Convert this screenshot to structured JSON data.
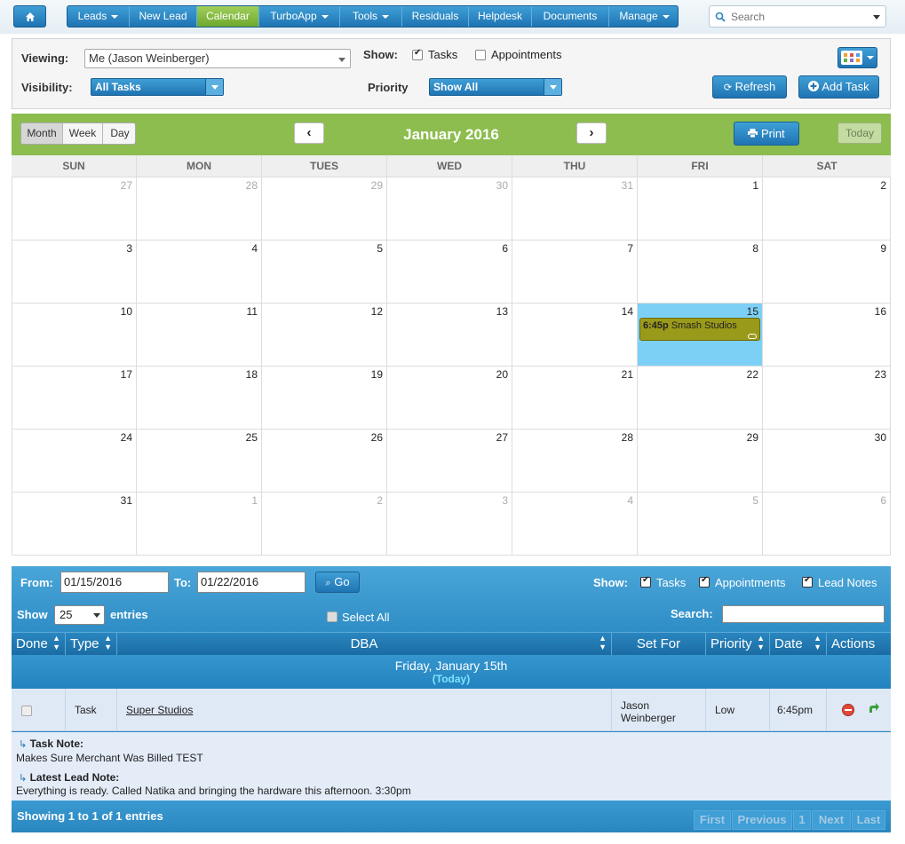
{
  "nav": {
    "items": [
      {
        "label": "Leads",
        "dropdown": true
      },
      {
        "label": "New Lead",
        "dropdown": false
      },
      {
        "label": "Calendar",
        "dropdown": false,
        "active": true
      },
      {
        "label": "TurboApp",
        "dropdown": true
      },
      {
        "label": "Tools",
        "dropdown": true
      },
      {
        "label": "Residuals",
        "dropdown": false
      },
      {
        "label": "Helpdesk",
        "dropdown": false
      },
      {
        "label": "Documents",
        "dropdown": false
      },
      {
        "label": "Manage",
        "dropdown": true
      }
    ],
    "search_placeholder": "Search"
  },
  "filters": {
    "viewing_label": "Viewing:",
    "viewing_value": "Me (Jason Weinberger)",
    "visibility_label": "Visibility:",
    "visibility_value": "All Tasks",
    "show_label": "Show:",
    "show_tasks": "Tasks",
    "show_appointments": "Appointments",
    "priority_label": "Priority",
    "priority_value": "Show All",
    "refresh_label": "Refresh",
    "add_task_label": "Add Task"
  },
  "calendar": {
    "view_tabs": [
      "Month",
      "Week",
      "Day"
    ],
    "active_view": "Month",
    "title": "January 2016",
    "prev_label": "‹",
    "next_label": "›",
    "print_label": "Print",
    "today_label": "Today",
    "weekdays": [
      "SUN",
      "MON",
      "TUES",
      "WED",
      "THU",
      "FRI",
      "SAT"
    ],
    "weeks": [
      [
        {
          "d": "27",
          "other": true
        },
        {
          "d": "28",
          "other": true
        },
        {
          "d": "29",
          "other": true
        },
        {
          "d": "30",
          "other": true
        },
        {
          "d": "31",
          "other": true
        },
        {
          "d": "1"
        },
        {
          "d": "2"
        }
      ],
      [
        {
          "d": "3"
        },
        {
          "d": "4"
        },
        {
          "d": "5"
        },
        {
          "d": "6"
        },
        {
          "d": "7"
        },
        {
          "d": "8"
        },
        {
          "d": "9"
        }
      ],
      [
        {
          "d": "10"
        },
        {
          "d": "11"
        },
        {
          "d": "12"
        },
        {
          "d": "13"
        },
        {
          "d": "14"
        },
        {
          "d": "15",
          "today": true
        },
        {
          "d": "16"
        }
      ],
      [
        {
          "d": "17"
        },
        {
          "d": "18"
        },
        {
          "d": "19"
        },
        {
          "d": "20"
        },
        {
          "d": "21"
        },
        {
          "d": "22"
        },
        {
          "d": "23"
        }
      ],
      [
        {
          "d": "24"
        },
        {
          "d": "25"
        },
        {
          "d": "26"
        },
        {
          "d": "27"
        },
        {
          "d": "28"
        },
        {
          "d": "29"
        },
        {
          "d": "30"
        }
      ],
      [
        {
          "d": "31"
        },
        {
          "d": "1",
          "other": true
        },
        {
          "d": "2",
          "other": true
        },
        {
          "d": "3",
          "other": true
        },
        {
          "d": "4",
          "other": true
        },
        {
          "d": "5",
          "other": true
        },
        {
          "d": "6",
          "other": true
        }
      ]
    ],
    "event": {
      "time": "6:45p",
      "title": "Smash Studios",
      "day": "15"
    }
  },
  "tasks": {
    "from_label": "From:",
    "from_value": "01/15/2016",
    "to_label": "To:",
    "to_value": "01/22/2016",
    "go_label": "Go",
    "show_label": "Show:",
    "show_tasks": "Tasks",
    "show_appointments": "Appointments",
    "show_lead_notes": "Lead Notes",
    "entries_prefix": "Show",
    "entries_value": "25",
    "entries_suffix": "entries",
    "select_all": "Select All",
    "search_label": "Search:",
    "columns": [
      "Done",
      "Type",
      "DBA",
      "Set For",
      "Priority",
      "Date",
      "Actions"
    ],
    "group_title": "Friday, January 15th",
    "group_subtitle": "(Today)",
    "row": {
      "type": "Task",
      "dba": "Super Studios",
      "set_for_first": "Jason",
      "set_for_last": "Weinberger",
      "priority": "Low",
      "date": "6:45pm"
    },
    "task_note_label": "Task Note:",
    "task_note": "Makes Sure Merchant Was Billed TEST",
    "lead_note_label": "Latest Lead Note:",
    "lead_note": "Everything is ready. Called Natika and bringing the hardware this afternoon. 3:30pm",
    "footer_info": "Showing 1 to 1 of 1 entries",
    "pager": [
      "First",
      "Previous",
      "1",
      "Next",
      "Last"
    ]
  },
  "colors": {
    "brand_blue": "#2a86bf",
    "calendar_green": "#8cbd4e",
    "today_cell": "#7dd0f5",
    "event_olive": "#9a9a1a"
  }
}
